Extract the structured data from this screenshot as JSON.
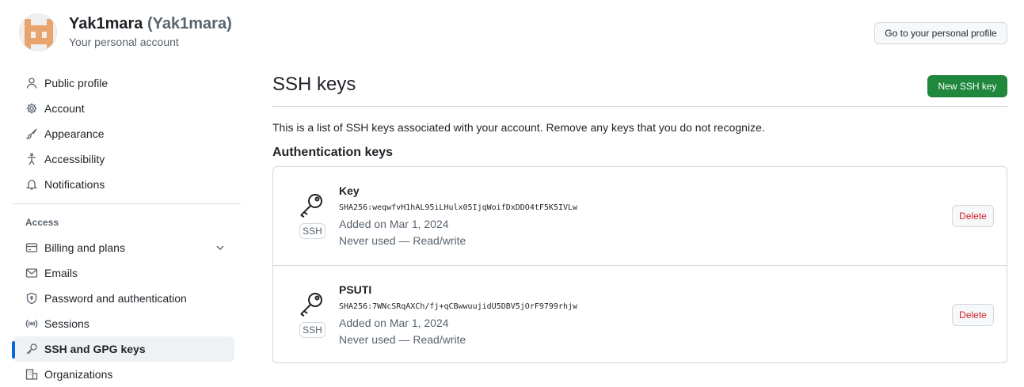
{
  "account": {
    "name": "Yak1mara",
    "login": "(Yak1mara)",
    "subtitle": "Your personal account",
    "profile_button": "Go to your personal profile"
  },
  "sidebar": {
    "items": [
      {
        "label": "Public profile",
        "icon": "person-icon"
      },
      {
        "label": "Account",
        "icon": "gear-icon"
      },
      {
        "label": "Appearance",
        "icon": "paintbrush-icon"
      },
      {
        "label": "Accessibility",
        "icon": "accessibility-icon"
      },
      {
        "label": "Notifications",
        "icon": "bell-icon"
      }
    ],
    "access_heading": "Access",
    "access_items": [
      {
        "label": "Billing and plans",
        "icon": "credit-card-icon"
      },
      {
        "label": "Emails",
        "icon": "mail-icon"
      },
      {
        "label": "Password and authentication",
        "icon": "shield-lock-icon"
      },
      {
        "label": "Sessions",
        "icon": "broadcast-icon"
      },
      {
        "label": "SSH and GPG keys",
        "icon": "key-icon"
      },
      {
        "label": "Organizations",
        "icon": "organization-icon"
      }
    ]
  },
  "main": {
    "title": "SSH keys",
    "new_button": "New SSH key",
    "intro": "This is a list of SSH keys associated with your account. Remove any keys that you do not recognize.",
    "section_heading": "Authentication keys",
    "keys": [
      {
        "title": "Key",
        "fingerprint": "SHA256:weqwfvH1hAL95iLHulx05IjqWoifDxDDO4tF5K5IVLw",
        "added": "Added on Mar 1, 2024",
        "usage": "Never used — Read/write",
        "badge": "SSH",
        "delete_label": "Delete"
      },
      {
        "title": "PSUTI",
        "fingerprint": "SHA256:7WNcSRqAXCh/fj+qCBwwuujidU5DBV5jOrF9799rhjw",
        "added": "Added on Mar 1, 2024",
        "usage": "Never used — Read/write",
        "badge": "SSH",
        "delete_label": "Delete"
      }
    ]
  },
  "colors": {
    "primary_green": "#1f883d",
    "danger_red": "#d1242f",
    "active_indicator": "#0969da",
    "avatar_orange": "#e8a46c"
  }
}
